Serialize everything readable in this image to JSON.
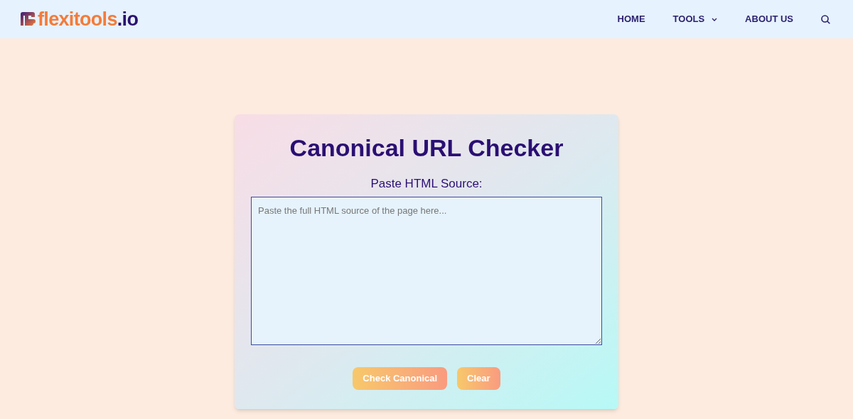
{
  "header": {
    "logo": {
      "name": "flexitools",
      "suffix": ".io"
    },
    "nav": [
      {
        "label": "HOME",
        "dropdown": false
      },
      {
        "label": "TOOLS",
        "dropdown": true
      },
      {
        "label": "ABOUT US",
        "dropdown": false
      }
    ]
  },
  "tool": {
    "title": "Canonical URL Checker",
    "field_label": "Paste HTML Source:",
    "source": {
      "placeholder": "Paste the full HTML source of the page here..."
    },
    "buttons": [
      "Check Canonical",
      "Clear"
    ]
  }
}
